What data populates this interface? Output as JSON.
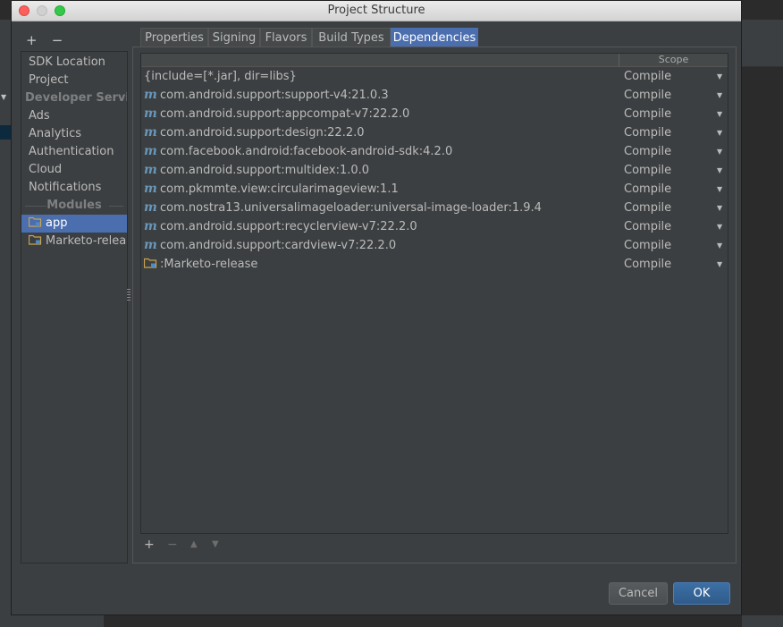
{
  "window": {
    "title": "Project Structure"
  },
  "sidebar": {
    "add_label": "+",
    "remove_label": "−",
    "items": [
      {
        "label": "SDK Location",
        "kind": "item"
      },
      {
        "label": "Project",
        "kind": "item"
      },
      {
        "label": "Developer Services",
        "kind": "section"
      },
      {
        "label": "Ads",
        "kind": "item"
      },
      {
        "label": "Analytics",
        "kind": "item"
      },
      {
        "label": "Authentication",
        "kind": "item"
      },
      {
        "label": "Cloud",
        "kind": "item"
      },
      {
        "label": "Notifications",
        "kind": "item"
      },
      {
        "label": "Modules",
        "kind": "section"
      },
      {
        "label": "app",
        "kind": "module",
        "selected": true
      },
      {
        "label": "Marketo-release",
        "kind": "module"
      }
    ]
  },
  "tabs": [
    {
      "label": "Properties"
    },
    {
      "label": "Signing"
    },
    {
      "label": "Flavors"
    },
    {
      "label": "Build Types"
    },
    {
      "label": "Dependencies",
      "active": true
    }
  ],
  "table": {
    "columns": [
      "",
      "Scope"
    ],
    "rows": [
      {
        "name": "{include=[*.jar], dir=libs}",
        "icon": "none",
        "scope": "Compile"
      },
      {
        "name": "com.android.support:support-v4:21.0.3",
        "icon": "maven-icon",
        "scope": "Compile"
      },
      {
        "name": "com.android.support:appcompat-v7:22.2.0",
        "icon": "maven-icon",
        "scope": "Compile"
      },
      {
        "name": "com.android.support:design:22.2.0",
        "icon": "maven-icon",
        "scope": "Compile"
      },
      {
        "name": "com.facebook.android:facebook-android-sdk:4.2.0",
        "icon": "maven-icon",
        "scope": "Compile"
      },
      {
        "name": "com.android.support:multidex:1.0.0",
        "icon": "maven-icon",
        "scope": "Compile"
      },
      {
        "name": "com.pkmmte.view:circularimageview:1.1",
        "icon": "maven-icon",
        "scope": "Compile"
      },
      {
        "name": "com.nostra13.universalimageloader:universal-image-loader:1.9.4",
        "icon": "maven-icon",
        "scope": "Compile"
      },
      {
        "name": "com.android.support:recyclerview-v7:22.2.0",
        "icon": "maven-icon",
        "scope": "Compile"
      },
      {
        "name": "com.android.support:cardview-v7:22.2.0",
        "icon": "maven-icon",
        "scope": "Compile"
      },
      {
        "name": ":Marketo-release",
        "icon": "module-folder-icon",
        "scope": "Compile"
      }
    ],
    "maven_glyph": "m",
    "dropdown_glyph": "▼"
  },
  "table_tools": {
    "add": "+",
    "remove": "−",
    "up": "▲",
    "down": "▼"
  },
  "buttons": {
    "cancel": "Cancel",
    "ok": "OK"
  },
  "colors": {
    "accent": "#4b6eaf",
    "maven_icon": "#6897bb",
    "folder": "#c9a34e",
    "module_badge": "#4f8ac7"
  }
}
